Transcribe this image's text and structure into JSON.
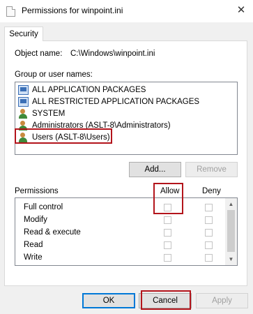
{
  "window": {
    "title": "Permissions for winpoint.ini",
    "close_glyph": "✕"
  },
  "tabs": [
    {
      "label": "Security"
    }
  ],
  "object": {
    "label": "Object name:",
    "value": "C:\\Windows\\winpoint.ini"
  },
  "groups": {
    "label": "Group or user names:",
    "items": [
      {
        "label": "ALL APPLICATION PACKAGES",
        "icon": "package-icon"
      },
      {
        "label": "ALL RESTRICTED APPLICATION PACKAGES",
        "icon": "package-icon"
      },
      {
        "label": "SYSTEM",
        "icon": "users-icon"
      },
      {
        "label": "Administrators (ASLT-8\\Administrators)",
        "icon": "users-icon"
      },
      {
        "label": "Users (ASLT-8\\Users)",
        "icon": "users-icon",
        "highlighted": true
      }
    ]
  },
  "buttons": {
    "add": "Add...",
    "remove": "Remove",
    "ok": "OK",
    "cancel": "Cancel",
    "apply": "Apply"
  },
  "permissions": {
    "label": "Permissions",
    "allow_header": "Allow",
    "deny_header": "Deny",
    "rows": [
      {
        "name": "Full control"
      },
      {
        "name": "Modify"
      },
      {
        "name": "Read & execute"
      },
      {
        "name": "Read"
      },
      {
        "name": "Write"
      }
    ]
  },
  "colors": {
    "highlight": "#b3141b",
    "accent": "#0078d7"
  }
}
